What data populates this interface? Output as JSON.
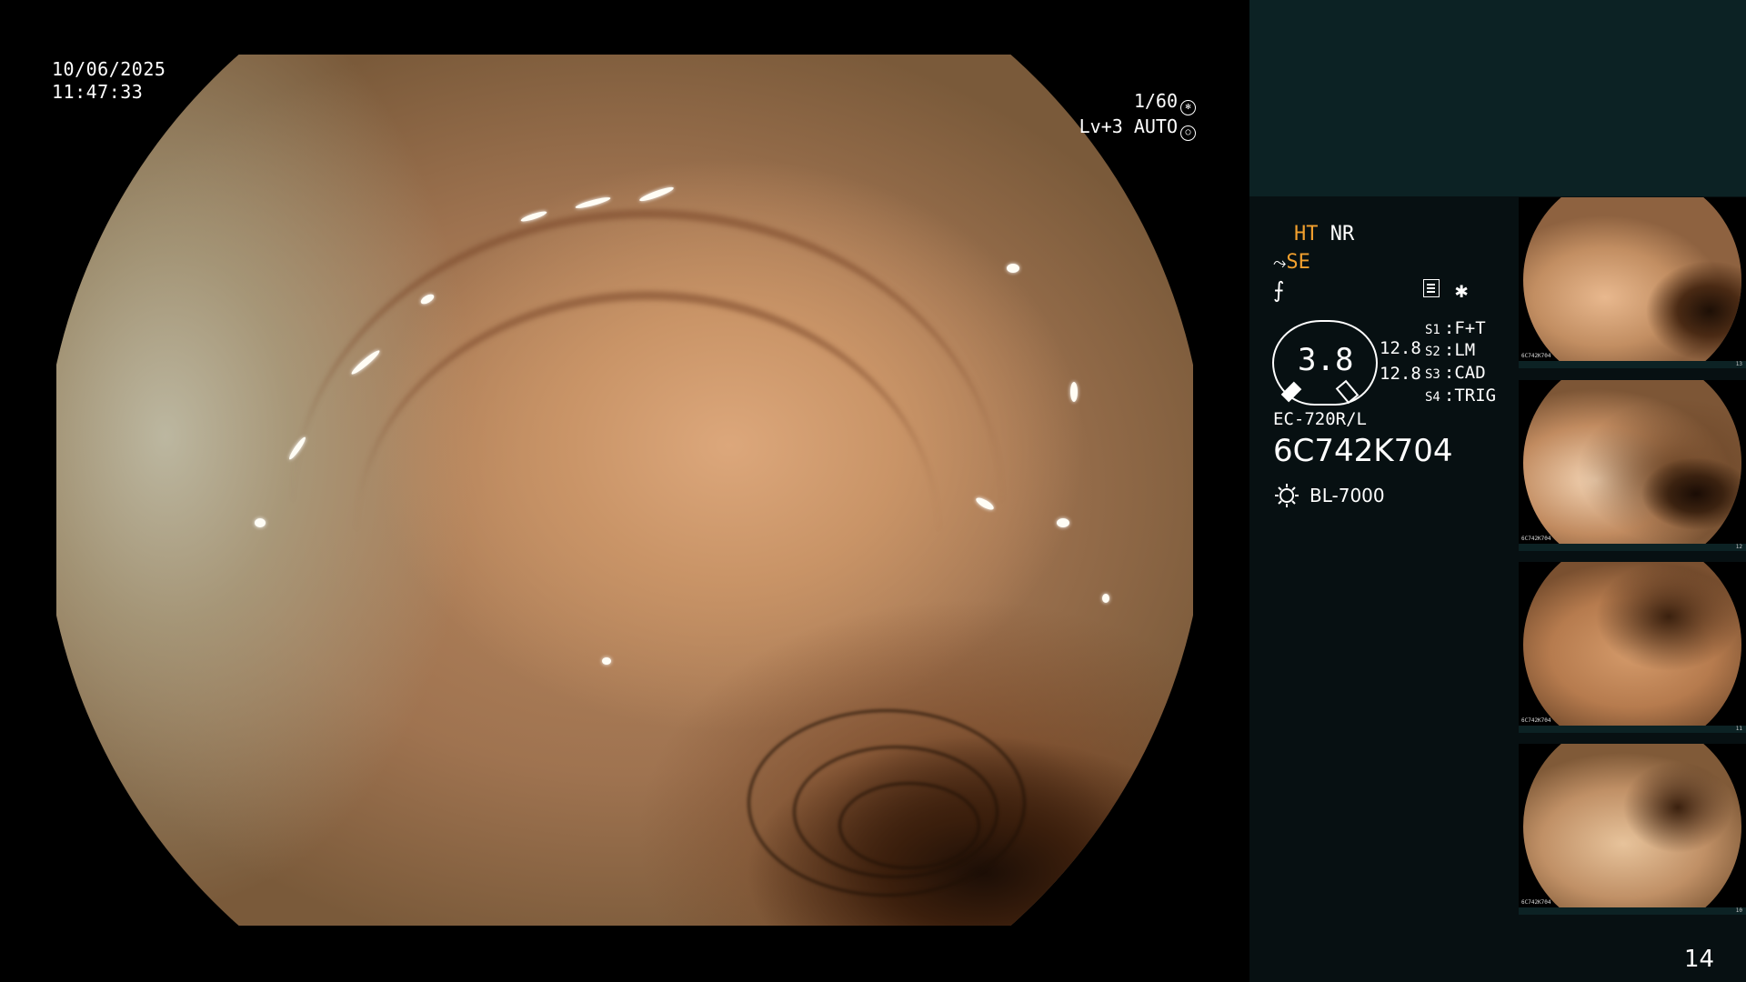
{
  "overlay": {
    "date": "10/06/2025",
    "time": "11:47:33",
    "shutter": "1/60",
    "level": "Lv+3 AUTO"
  },
  "panel": {
    "ht": "HT",
    "nr": "NR",
    "se": "SE",
    "dial_value": "3.8",
    "ev_top": "12.8",
    "ev_bottom": "12.8",
    "switches": [
      {
        "key": "S1",
        "value": "F+T"
      },
      {
        "key": "S2",
        "value": "LM"
      },
      {
        "key": "S3",
        "value": "CAD"
      },
      {
        "key": "S4",
        "value": "TRIG"
      }
    ],
    "scope_model": "EC-720R/L",
    "scope_serial": "6C742K704",
    "light_source": "BL-7000",
    "page": "14"
  },
  "thumbnails": [
    {
      "label": "6C742K704",
      "frame": "13"
    },
    {
      "label": "6C742K704",
      "frame": "12"
    },
    {
      "label": "6C742K704",
      "frame": "11"
    },
    {
      "label": "6C742K704",
      "frame": "10"
    }
  ],
  "colors": {
    "accent_orange": "#f2a02e",
    "panel_top": "#0c2224",
    "panel_side": "#071012"
  }
}
